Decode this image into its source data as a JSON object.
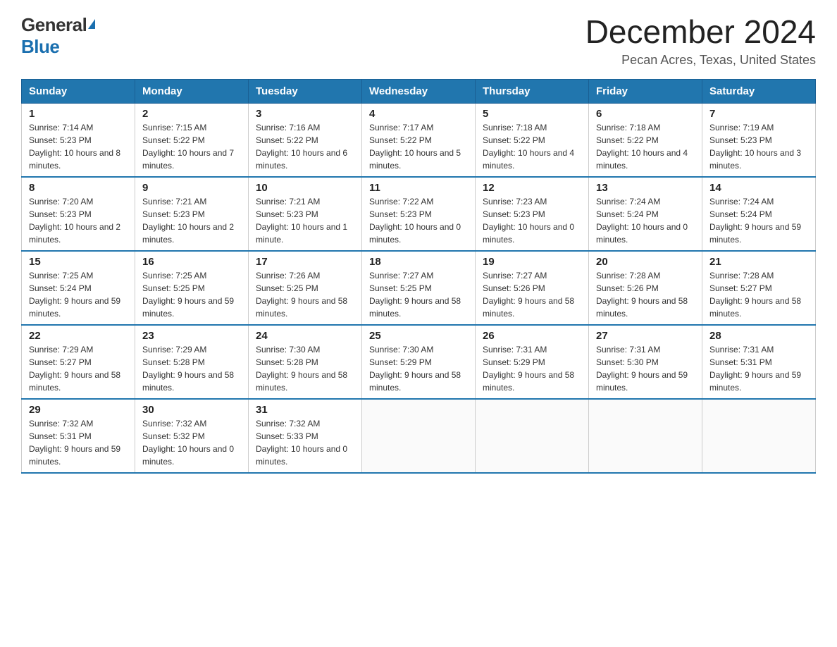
{
  "logo": {
    "general": "General",
    "blue": "Blue"
  },
  "title": "December 2024",
  "subtitle": "Pecan Acres, Texas, United States",
  "days_of_week": [
    "Sunday",
    "Monday",
    "Tuesday",
    "Wednesday",
    "Thursday",
    "Friday",
    "Saturday"
  ],
  "weeks": [
    [
      {
        "day": "1",
        "sunrise": "7:14 AM",
        "sunset": "5:23 PM",
        "daylight": "10 hours and 8 minutes."
      },
      {
        "day": "2",
        "sunrise": "7:15 AM",
        "sunset": "5:22 PM",
        "daylight": "10 hours and 7 minutes."
      },
      {
        "day": "3",
        "sunrise": "7:16 AM",
        "sunset": "5:22 PM",
        "daylight": "10 hours and 6 minutes."
      },
      {
        "day": "4",
        "sunrise": "7:17 AM",
        "sunset": "5:22 PM",
        "daylight": "10 hours and 5 minutes."
      },
      {
        "day": "5",
        "sunrise": "7:18 AM",
        "sunset": "5:22 PM",
        "daylight": "10 hours and 4 minutes."
      },
      {
        "day": "6",
        "sunrise": "7:18 AM",
        "sunset": "5:22 PM",
        "daylight": "10 hours and 4 minutes."
      },
      {
        "day": "7",
        "sunrise": "7:19 AM",
        "sunset": "5:23 PM",
        "daylight": "10 hours and 3 minutes."
      }
    ],
    [
      {
        "day": "8",
        "sunrise": "7:20 AM",
        "sunset": "5:23 PM",
        "daylight": "10 hours and 2 minutes."
      },
      {
        "day": "9",
        "sunrise": "7:21 AM",
        "sunset": "5:23 PM",
        "daylight": "10 hours and 2 minutes."
      },
      {
        "day": "10",
        "sunrise": "7:21 AM",
        "sunset": "5:23 PM",
        "daylight": "10 hours and 1 minute."
      },
      {
        "day": "11",
        "sunrise": "7:22 AM",
        "sunset": "5:23 PM",
        "daylight": "10 hours and 0 minutes."
      },
      {
        "day": "12",
        "sunrise": "7:23 AM",
        "sunset": "5:23 PM",
        "daylight": "10 hours and 0 minutes."
      },
      {
        "day": "13",
        "sunrise": "7:24 AM",
        "sunset": "5:24 PM",
        "daylight": "10 hours and 0 minutes."
      },
      {
        "day": "14",
        "sunrise": "7:24 AM",
        "sunset": "5:24 PM",
        "daylight": "9 hours and 59 minutes."
      }
    ],
    [
      {
        "day": "15",
        "sunrise": "7:25 AM",
        "sunset": "5:24 PM",
        "daylight": "9 hours and 59 minutes."
      },
      {
        "day": "16",
        "sunrise": "7:25 AM",
        "sunset": "5:25 PM",
        "daylight": "9 hours and 59 minutes."
      },
      {
        "day": "17",
        "sunrise": "7:26 AM",
        "sunset": "5:25 PM",
        "daylight": "9 hours and 58 minutes."
      },
      {
        "day": "18",
        "sunrise": "7:27 AM",
        "sunset": "5:25 PM",
        "daylight": "9 hours and 58 minutes."
      },
      {
        "day": "19",
        "sunrise": "7:27 AM",
        "sunset": "5:26 PM",
        "daylight": "9 hours and 58 minutes."
      },
      {
        "day": "20",
        "sunrise": "7:28 AM",
        "sunset": "5:26 PM",
        "daylight": "9 hours and 58 minutes."
      },
      {
        "day": "21",
        "sunrise": "7:28 AM",
        "sunset": "5:27 PM",
        "daylight": "9 hours and 58 minutes."
      }
    ],
    [
      {
        "day": "22",
        "sunrise": "7:29 AM",
        "sunset": "5:27 PM",
        "daylight": "9 hours and 58 minutes."
      },
      {
        "day": "23",
        "sunrise": "7:29 AM",
        "sunset": "5:28 PM",
        "daylight": "9 hours and 58 minutes."
      },
      {
        "day": "24",
        "sunrise": "7:30 AM",
        "sunset": "5:28 PM",
        "daylight": "9 hours and 58 minutes."
      },
      {
        "day": "25",
        "sunrise": "7:30 AM",
        "sunset": "5:29 PM",
        "daylight": "9 hours and 58 minutes."
      },
      {
        "day": "26",
        "sunrise": "7:31 AM",
        "sunset": "5:29 PM",
        "daylight": "9 hours and 58 minutes."
      },
      {
        "day": "27",
        "sunrise": "7:31 AM",
        "sunset": "5:30 PM",
        "daylight": "9 hours and 59 minutes."
      },
      {
        "day": "28",
        "sunrise": "7:31 AM",
        "sunset": "5:31 PM",
        "daylight": "9 hours and 59 minutes."
      }
    ],
    [
      {
        "day": "29",
        "sunrise": "7:32 AM",
        "sunset": "5:31 PM",
        "daylight": "9 hours and 59 minutes."
      },
      {
        "day": "30",
        "sunrise": "7:32 AM",
        "sunset": "5:32 PM",
        "daylight": "10 hours and 0 minutes."
      },
      {
        "day": "31",
        "sunrise": "7:32 AM",
        "sunset": "5:33 PM",
        "daylight": "10 hours and 0 minutes."
      },
      null,
      null,
      null,
      null
    ]
  ]
}
